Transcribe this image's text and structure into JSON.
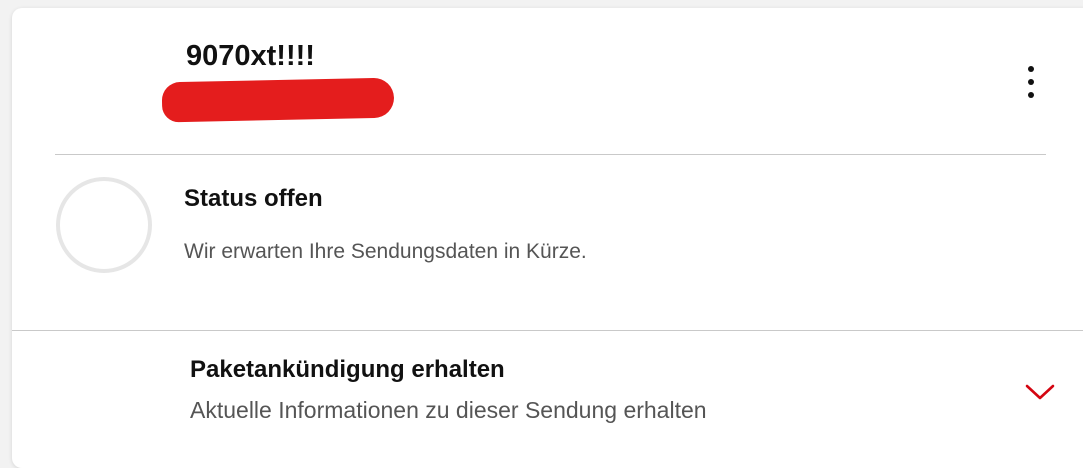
{
  "shipment": {
    "tracking_number": "9070xt!!!!"
  },
  "status": {
    "title": "Status offen",
    "description": "Wir erwarten Ihre Sendungsdaten in Kürze."
  },
  "notification": {
    "title": "Paketankündigung erhalten",
    "subtitle": "Aktuelle Informationen zu dieser Sendung erhalten"
  },
  "icons": {
    "more": "more-vertical-icon",
    "status": "progress-ring-icon",
    "expand": "chevron-down-icon"
  },
  "colors": {
    "accent": "#d40511",
    "redaction": "#e41d1d",
    "ring": "#e6e6e6"
  }
}
